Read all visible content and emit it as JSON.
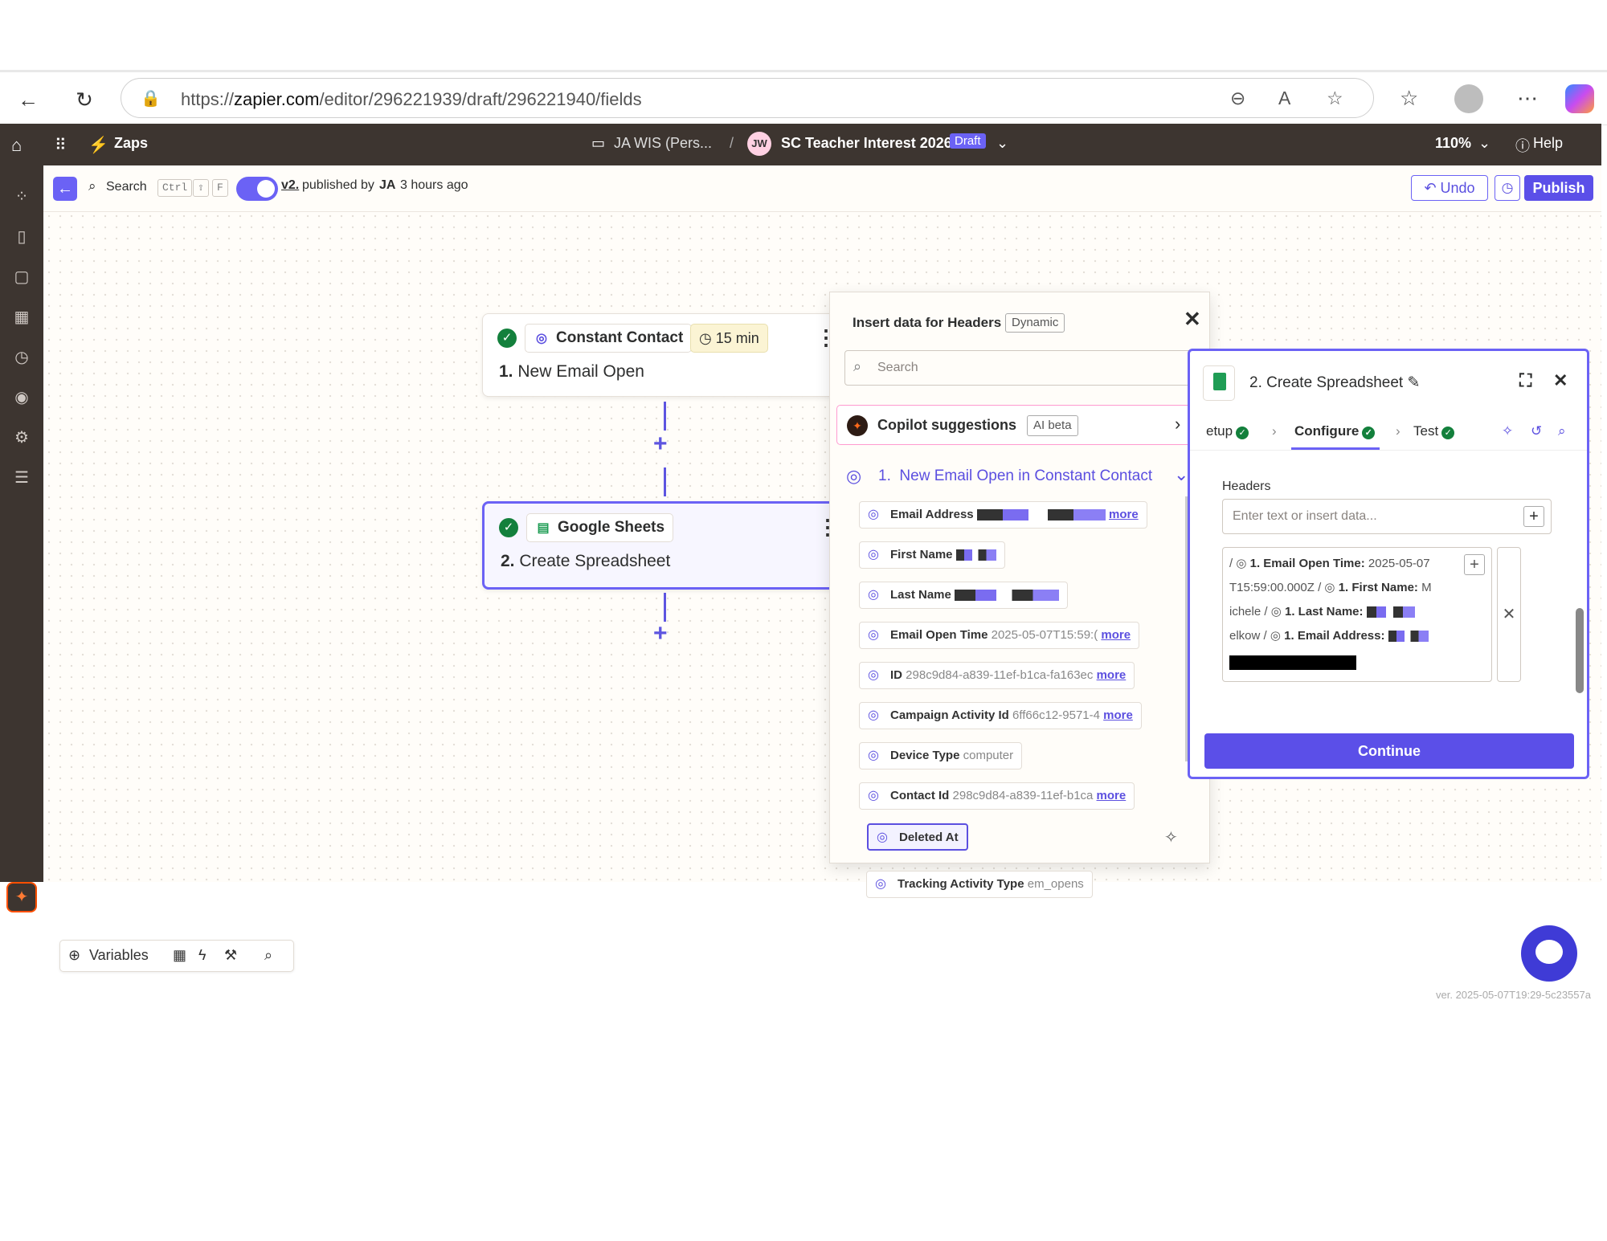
{
  "browser": {
    "url_prefix": "https://",
    "url_host": "zapier.com",
    "url_path": "/editor/296221939/draft/296221940/fields"
  },
  "topbar": {
    "apps_label": "Zaps",
    "folder": "JA WIS (Pers...",
    "separator": "/",
    "owner_initials": "JW",
    "zap_name": "SC Teacher Interest 2026",
    "status_badge": "Draft",
    "zoom": "110%",
    "help": "Help"
  },
  "toolbar": {
    "search": "Search",
    "kbd1": "Ctrl",
    "kbd2": "⇧",
    "kbd3": "F",
    "version": "v2.",
    "published_text": "published by",
    "published_by": "JA",
    "published_time": "3 hours ago",
    "undo": "Undo",
    "publish": "Publish"
  },
  "steps": [
    {
      "app": "Constant Contact",
      "num": "1.",
      "title": "New Email Open",
      "time": "15 min"
    },
    {
      "app": "Google Sheets",
      "num": "2.",
      "title": "Create Spreadsheet"
    }
  ],
  "picker": {
    "header": "Insert data for Headers",
    "badge": "Dynamic",
    "search_placeholder": "Search",
    "copilot": "Copilot suggestions",
    "copilot_badge": "AI beta",
    "group_num": "1.",
    "group": "New Email Open in Constant Contact",
    "fields": [
      {
        "key": "Email Address",
        "value": "",
        "more": "more"
      },
      {
        "key": "First Name",
        "value": "",
        "more": ""
      },
      {
        "key": "Last Name",
        "value": "",
        "more": ""
      },
      {
        "key": "Email Open Time",
        "value": "2025-05-07T15:59:(",
        "more": "more"
      },
      {
        "key": "ID",
        "value": "298c9d84-a839-11ef-b1ca-fa163ec",
        "more": "more"
      },
      {
        "key": "Campaign Activity Id",
        "value": "6ff66c12-9571-4",
        "more": "more"
      },
      {
        "key": "Device Type",
        "value": "computer",
        "more": ""
      },
      {
        "key": "Contact Id",
        "value": "298c9d84-a839-11ef-b1ca",
        "more": "more"
      },
      {
        "key": "Deleted At",
        "value": "",
        "more": ""
      },
      {
        "key": "Tracking Activity Type",
        "value": "em_opens",
        "more": ""
      }
    ]
  },
  "panel": {
    "title": "2. Create Spreadsheet",
    "tab_setup": "etup",
    "tab_configure": "Configure",
    "tab_test": "Test",
    "headers_label": "Headers",
    "headers_placeholder": "Enter text or insert data...",
    "val_row1_a": "/",
    "val_row1_b": "1. Email Open Time:",
    "val_row1_c": "2025-05-07",
    "val_row2_a": "T15:59:00.000Z",
    "val_row2_b": "/",
    "val_row2_c": "1. First Name:",
    "val_row2_d": "M",
    "val_row3_a": "ichele",
    "val_row3_b": "/",
    "val_row3_c": "1. Last Name:",
    "val_row4_a": "elkow",
    "val_row4_b": "/",
    "val_row4_c": "1. Email Address:",
    "continue": "Continue"
  },
  "bottom": {
    "variables": "Variables"
  },
  "version_text": "ver. 2025-05-07T19:29-5c23557a"
}
